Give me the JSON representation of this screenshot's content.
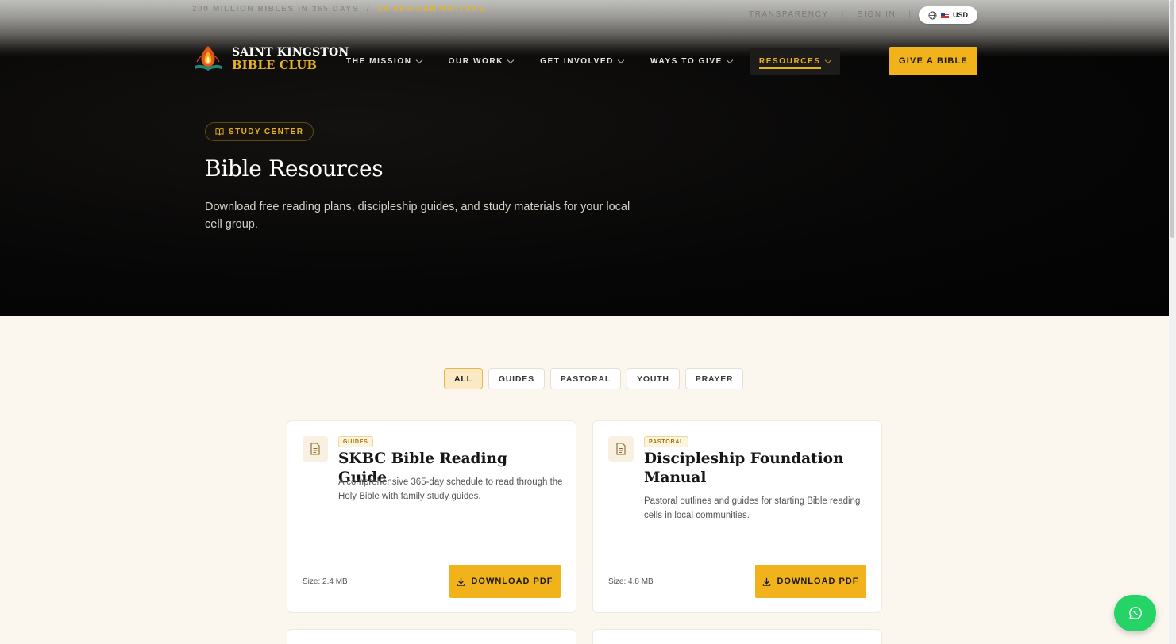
{
  "topbar": {
    "announcement_muted": "200 MILLION BIBLES IN 365 DAYS",
    "separator": "/",
    "announcement_highlight": "54 AFRICAN NATIONS",
    "links": [
      "TRANSPARENCY",
      "SIGN IN"
    ],
    "currency": "USD"
  },
  "brand": {
    "line1": "SAINT KINGSTON",
    "line2": "BIBLE CLUB"
  },
  "nav": {
    "items": [
      {
        "label": "THE MISSION"
      },
      {
        "label": "OUR WORK"
      },
      {
        "label": "GET INVOLVED"
      },
      {
        "label": "WAYS TO GIVE"
      },
      {
        "label": "RESOURCES",
        "active": true
      }
    ],
    "cta": "GIVE A BIBLE"
  },
  "hero": {
    "badge": "STUDY CENTER",
    "title": "Bible Resources",
    "subtitle": "Download free reading plans, discipleship guides, and study materials for your local cell group."
  },
  "filters": {
    "items": [
      "ALL",
      "GUIDES",
      "PASTORAL",
      "YOUTH",
      "PRAYER"
    ],
    "active": "ALL"
  },
  "resources": [
    {
      "tag": "GUIDES",
      "title": "SKBC Bible Reading Guide",
      "description": "A comprehensive 365-day schedule to read through the Holy Bible with family study guides.",
      "size": "Size: 2.4 MB",
      "button": "DOWNLOAD PDF"
    },
    {
      "tag": "PASTORAL",
      "title": "Discipleship Foundation Manual",
      "description": "Pastoral outlines and guides for starting Bible reading cells in local communities.",
      "size": "Size: 4.8 MB",
      "button": "DOWNLOAD PDF"
    }
  ],
  "colors": {
    "accent": "#f2b21c",
    "gold_text": "#e9b223",
    "hero_bg": "#050505",
    "page_bg": "#fbf7ef",
    "whatsapp": "#25d366"
  },
  "icons": {
    "currency": "globe-icon",
    "badge": "open-book-icon",
    "card": "document-icon",
    "download": "download-icon",
    "floating": "whatsapp-icon"
  }
}
